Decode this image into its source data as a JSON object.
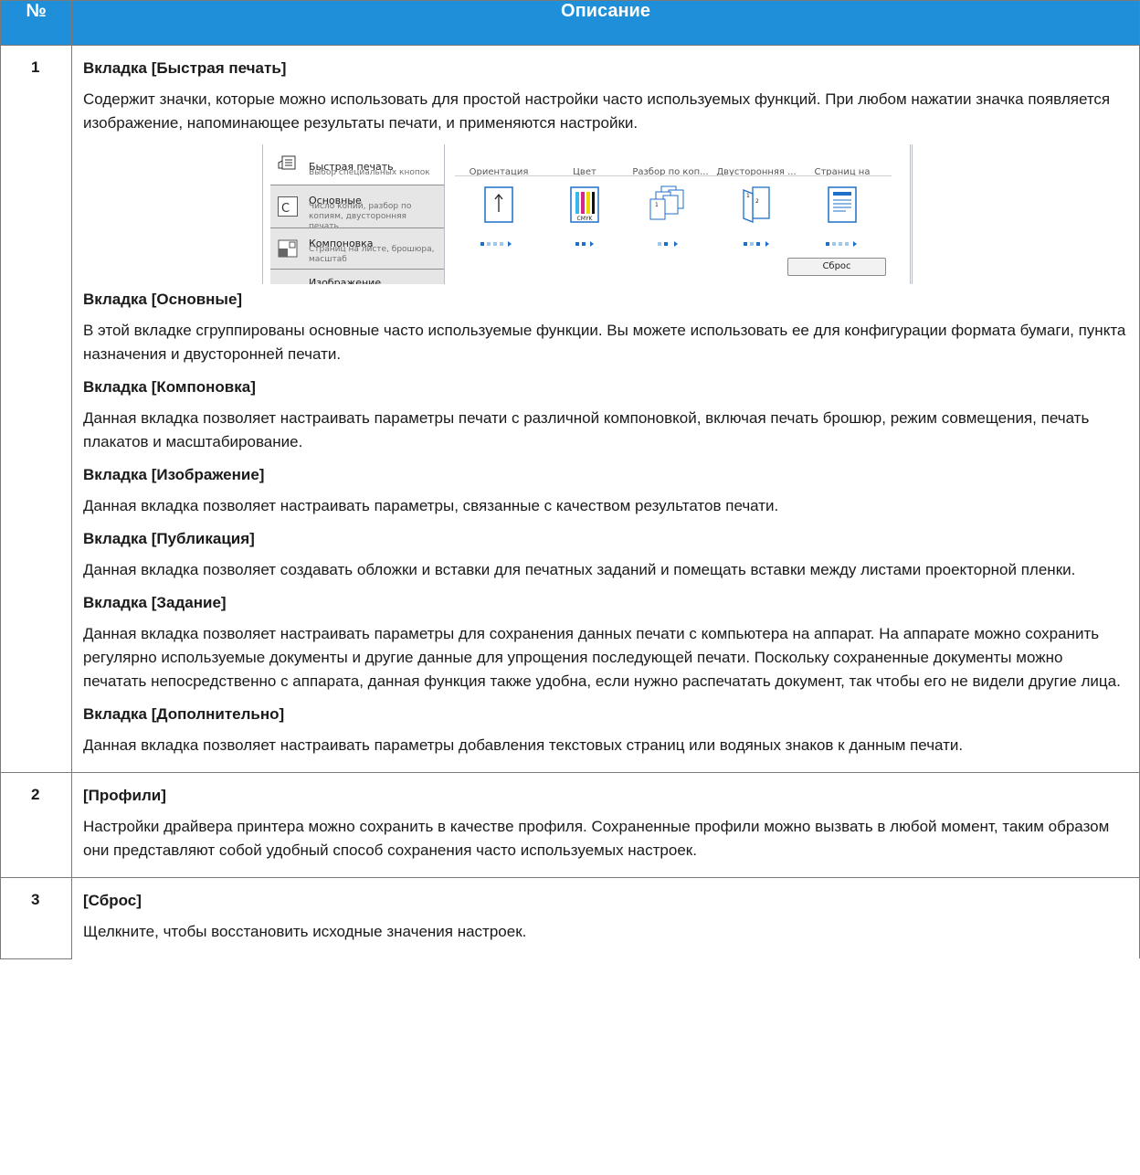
{
  "header": {
    "num": "№",
    "desc": "Описание"
  },
  "rows": [
    {
      "num": "1",
      "sections": [
        {
          "title": "Вкладка [Быстрая печать]",
          "text": "Содержит значки, которые можно использовать для простой настройки часто используемых функций. При любом нажатии значка появляется изображение, напоминающее результаты печати, и применяются настройки."
        },
        {
          "title": "Вкладка [Основные]",
          "text": "В этой вкладке сгруппированы основные часто используемые функции. Вы можете использовать ее для конфигурации формата бумаги, пункта назначения и двусторонней печати."
        },
        {
          "title": "Вкладка [Компоновка]",
          "text": "Данная вкладка позволяет настраивать параметры печати с различной компоновкой, включая печать брошюр, режим совмещения, печать плакатов и масштабирование."
        },
        {
          "title": "Вкладка [Изображение]",
          "text": "Данная вкладка позволяет настраивать параметры, связанные с качеством результатов печати."
        },
        {
          "title": "Вкладка [Публикация]",
          "text": "Данная вкладка позволяет создавать обложки и вставки для печатных заданий и помещать вставки между листами проекторной пленки."
        },
        {
          "title": "Вкладка [Задание]",
          "text": "Данная вкладка позволяет настраивать параметры для сохранения данных печати с компьютера на аппарат. На аппарате можно сохранить регулярно используемые документы и другие данные для упрощения последующей печати. Поскольку сохраненные документы можно печатать непосредственно с аппарата, данная функция также удобна, если нужно распечатать документ, так чтобы его не видели другие лица."
        },
        {
          "title": "Вкладка [Дополнительно]",
          "text": "Данная вкладка позволяет настраивать параметры добавления текстовых страниц или водяных знаков к данным печати."
        }
      ]
    },
    {
      "num": "2",
      "sections": [
        {
          "title": "[Профили]",
          "text": "Настройки драйвера принтера можно сохранить в качестве профиля. Сохраненные профили можно вызвать в любой момент, таким образом они представляют собой удобный способ сохранения часто используемых настроек."
        }
      ]
    },
    {
      "num": "3",
      "sections": [
        {
          "title": "[Сброс]",
          "text": "Щелкните, чтобы восстановить исходные значения настроек."
        }
      ]
    }
  ],
  "screenshot": {
    "tabs": [
      {
        "title": "Быстрая печать",
        "subtitle": "Выбор специальных кнопок"
      },
      {
        "title": "Основные",
        "subtitle": "Число копий, разбор по копиям, двусторонняя печать"
      },
      {
        "title": "Компоновка",
        "subtitle": "Страниц на листе, брошюра, масштаб"
      },
      {
        "title": "Изображение",
        "subtitle": ""
      }
    ],
    "columns": [
      "Ориентация",
      "Цвет",
      "Разбор по коп...",
      "Двусторонняя ...",
      "Страниц на лис..."
    ],
    "cmyk_label": "CMYK",
    "reset_label": "Сброс",
    "colors": {
      "header": "#1e8fd8",
      "accent": "#1e6fc8",
      "cyan": "#36b9e8",
      "magenta": "#d6288a",
      "yellow": "#f0d500",
      "black": "#111111"
    }
  }
}
